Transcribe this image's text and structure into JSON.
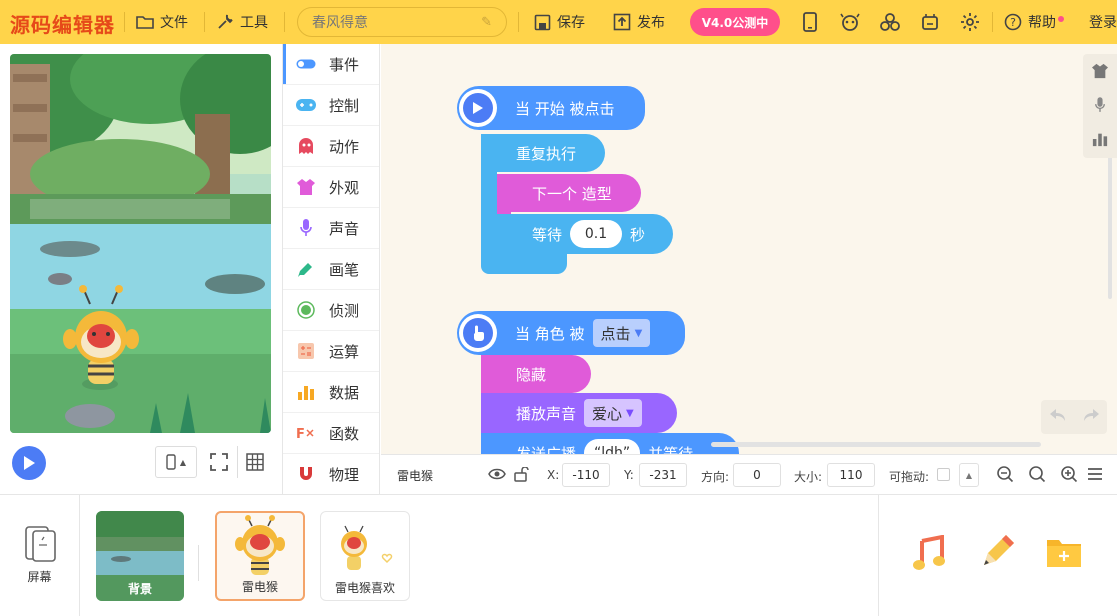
{
  "topbar": {
    "logo": "源码编辑器",
    "file_label": "文件",
    "tools_label": "工具",
    "project_name": "春风得意",
    "save_label": "保存",
    "publish_label": "发布",
    "version_label": "V4.0公测中",
    "help_label": "帮助",
    "login_label": "登录"
  },
  "categories": [
    {
      "label": "事件",
      "color": "#4c97ff"
    },
    {
      "label": "控制",
      "color": "#4ab4f1"
    },
    {
      "label": "动作",
      "color": "#e64a5f"
    },
    {
      "label": "外观",
      "color": "#e05bd9"
    },
    {
      "label": "声音",
      "color": "#9966ff"
    },
    {
      "label": "画笔",
      "color": "#2db88a"
    },
    {
      "label": "侦测",
      "color": "#5cb95c"
    },
    {
      "label": "运算",
      "color": "#f4a27a"
    },
    {
      "label": "数据",
      "color": "#f7a823"
    },
    {
      "label": "函数",
      "color": "#f06e4f"
    },
    {
      "label": "物理",
      "color": "#d93a3a"
    }
  ],
  "script1": {
    "hat": "当 开始 被点击",
    "repeat": "重复执行",
    "next_costume": "下一个 造型",
    "wait_prefix": "等待",
    "wait_value": "0.1",
    "wait_suffix": "秒"
  },
  "script2": {
    "hat_prefix": "当 角色 被",
    "hat_option": "点击",
    "hide": "隐藏",
    "play_sound": "播放声音",
    "sound_option": "爱心",
    "broadcast_prefix": "发送广播",
    "broadcast_value": "“ldh”",
    "broadcast_suffix": "并等待"
  },
  "props": {
    "sprite_name": "雷电猴",
    "x_label": "X:",
    "x_value": "-110",
    "y_label": "Y:",
    "y_value": "-231",
    "dir_label": "方向:",
    "dir_value": "0",
    "size_label": "大小:",
    "size_value": "110",
    "drag_label": "可拖动:"
  },
  "spritebar": {
    "screen_label": "屏幕",
    "background_label": "背景",
    "sprites": [
      {
        "label": "雷电猴",
        "selected": true
      },
      {
        "label": "雷电猴喜欢",
        "selected": false
      }
    ]
  },
  "colors": {
    "topbar": "#ffd44a",
    "version_badge": "#ff4f8b",
    "event": "#4c97ff",
    "control": "#4ab4f1",
    "looks": "#e05bd9",
    "sound": "#9966ff",
    "workspace": "#fbf6ec"
  }
}
